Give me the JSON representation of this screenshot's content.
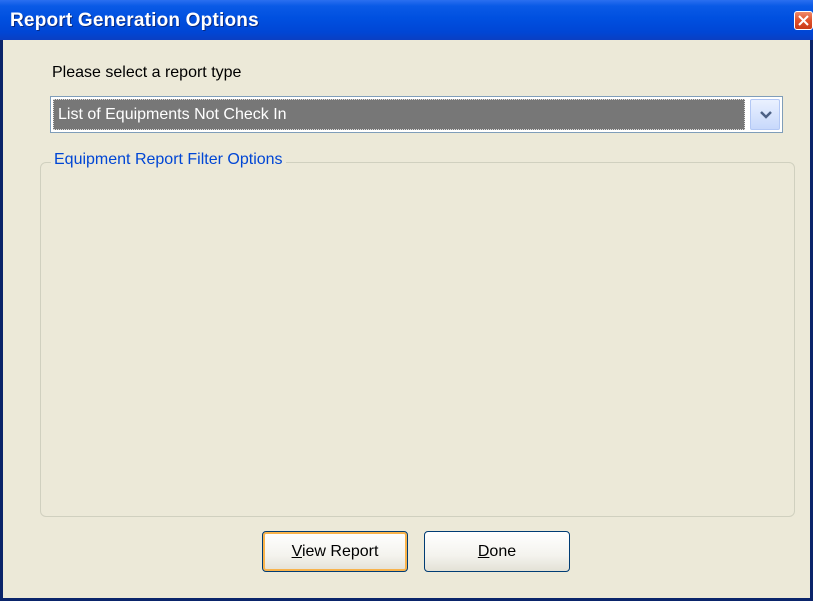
{
  "window": {
    "title": "Report Generation Options"
  },
  "form": {
    "prompt_label": "Please select a report type",
    "report_type": {
      "selected": "List of Equipments Not Check In"
    },
    "filter_group": {
      "legend": "Equipment Report Filter Options"
    }
  },
  "buttons": {
    "view_report": {
      "mnemonic": "V",
      "rest": "iew Report"
    },
    "done": {
      "mnemonic": "D",
      "rest": "one"
    }
  },
  "icons": {
    "close": "close-icon",
    "dropdown": "chevron-down-icon"
  },
  "colors": {
    "titlebar": "#0050e0",
    "dialog_bg": "#ece9d8",
    "legend_text": "#0046d5",
    "selection_bg": "#777777",
    "close_button": "#e0502a"
  }
}
